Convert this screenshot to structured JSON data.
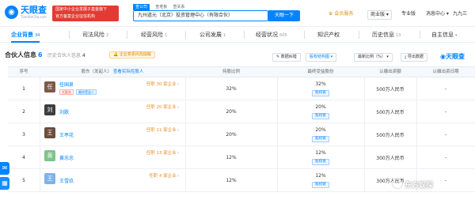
{
  "header": {
    "logo_name": "天眼查",
    "logo_sub": "TianYanCha.com",
    "promo_lines": [
      "国家中小企业发展子基金旗下",
      "官方备案企业征信机构"
    ],
    "search_tabs": [
      "查公司",
      "查老板",
      "查关系"
    ],
    "search_value": "九州道元（北京）投资管理中心（有限合伙）",
    "search_button": "天眼一下",
    "member_label": "会员服务",
    "enterprise_label": "商业版",
    "pro_label": "专业版",
    "messages_label": "消息中心",
    "user_label": "九九三"
  },
  "tabs": [
    {
      "label": "企业背景",
      "count": "34",
      "active": true
    },
    {
      "label": "司法风险",
      "count": "2",
      "active": false
    },
    {
      "label": "经营风险",
      "count": "1",
      "active": false
    },
    {
      "label": "公司发展",
      "count": "1",
      "active": false
    },
    {
      "label": "经营状况",
      "count": "505",
      "active": false
    },
    {
      "label": "知识产权",
      "count": "",
      "active": false
    },
    {
      "label": "历史信息",
      "count": "13",
      "active": false
    },
    {
      "label": "自主信息",
      "count": "",
      "active": false
    }
  ],
  "section": {
    "title": "合伙人信息",
    "count": "6",
    "history_label": "历史合伙人信息",
    "history_count": "4",
    "tip": "企业变更风险提醒",
    "btn_data": "数据纠错",
    "btn_structure": "股权结构图",
    "btn_sort": "最新比例（%）",
    "btn_export": "导出数据",
    "brand": "天眼查"
  },
  "table": {
    "headers": {
      "index": "序号",
      "partner": "股东（发起人）",
      "partner_link": "查看实际控股人",
      "ratio": "持股比例",
      "benefit": "最终受益股份",
      "capital": "认缴出资额",
      "date": "认缴出资日期"
    },
    "rows": [
      {
        "index": "1",
        "avatar": "任",
        "name": "任国泉",
        "tags": [
          "大股东",
          "最终受益人"
        ],
        "office": "任职 30 家企业",
        "ratio": "32%",
        "benefit": "32%",
        "benefit_tag": "股权链",
        "capital": "500万人民币",
        "date": "-"
      },
      {
        "index": "2",
        "avatar": "刘",
        "name": "刘歌",
        "tags": [],
        "office": "任职 20 家企业",
        "ratio": "20%",
        "benefit": "20%",
        "benefit_tag": "股权链",
        "capital": "500万人民币",
        "date": "-"
      },
      {
        "index": "3",
        "avatar": "王",
        "name": "王亭花",
        "tags": [],
        "office": "任职 11 家企业",
        "ratio": "20%",
        "benefit": "20%",
        "benefit_tag": "股权链",
        "capital": "500万人民币",
        "date": "-"
      },
      {
        "index": "4",
        "avatar": "黄",
        "name": "黄忠忠",
        "tags": [],
        "office": "任职 13 家企业",
        "ratio": "12%",
        "benefit": "12%",
        "benefit_tag": "股权链",
        "capital": "300万人民币",
        "date": "-"
      },
      {
        "index": "5",
        "avatar": "王",
        "name": "王雪玖",
        "tags": [],
        "office": "任职 4 家企业",
        "ratio": "12%",
        "benefit": "12%",
        "benefit_tag": "股权链",
        "capital": "300万人民币",
        "date": "-"
      }
    ]
  },
  "watermark": "东方娱探",
  "colors": {
    "brand_blue": "#0084ff",
    "red": "#e23b33",
    "orange": "#e78d2b"
  }
}
